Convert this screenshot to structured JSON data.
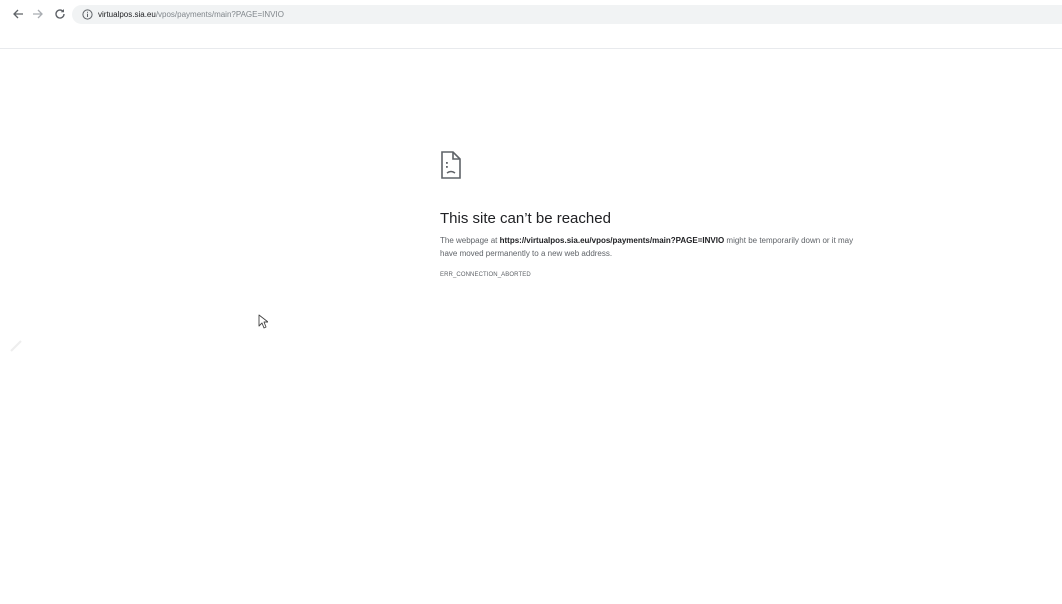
{
  "browser": {
    "address_bar": {
      "host": "virtualpos.sia.eu",
      "path": "/vpos/payments/main?PAGE=INVIO"
    }
  },
  "error_page": {
    "icon": "sad-page-icon",
    "title": "This site can’t be reached",
    "desc_prefix": "The webpage at ",
    "desc_url": "https://virtualpos.sia.eu/vpos/payments/main?PAGE=INVIO",
    "desc_suffix": " might be temporarily down or it may have moved permanently to a new web address.",
    "error_code": "ERR_CONNECTION_ABORTED"
  },
  "colors": {
    "text_primary": "#202124",
    "text_secondary": "#5f6368",
    "omnibox_bg": "#f1f3f4"
  }
}
